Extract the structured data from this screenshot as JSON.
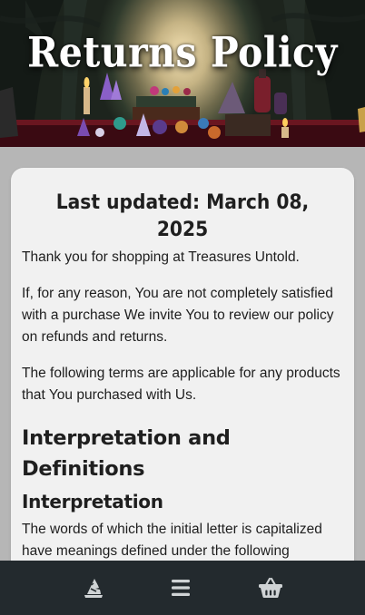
{
  "hero": {
    "title": "Returns Policy"
  },
  "content": {
    "last_updated": "Last updated: March 08, 2025",
    "intro": "Thank you for shopping at Treasures Untold.",
    "reason": "If, for any reason, You are not completely satisfied with a purchase We invite You to review our policy on refunds and returns.",
    "terms": "The following terms are applicable for any products that You purchased with Us.",
    "section_heading": "Interpretation and Definitions",
    "subsection_heading": "Interpretation",
    "interpretation_text": "The words of which the initial letter is capitalized have meanings defined under the following conditions. The following definitions shall have the same meaning regardless of whether they appear in singular or in plural."
  },
  "bottom_nav": {
    "items": [
      {
        "name": "home",
        "icon": "wizard-hat-icon"
      },
      {
        "name": "menu",
        "icon": "hamburger-menu-icon"
      },
      {
        "name": "cart",
        "icon": "shopping-basket-icon"
      }
    ]
  },
  "colors": {
    "page_background": "#b6b6b6",
    "card_background": "#f1f1f1",
    "nav_background": "#232a2e",
    "nav_icon": "#cfd3d5",
    "text": "#1e1e1e"
  }
}
